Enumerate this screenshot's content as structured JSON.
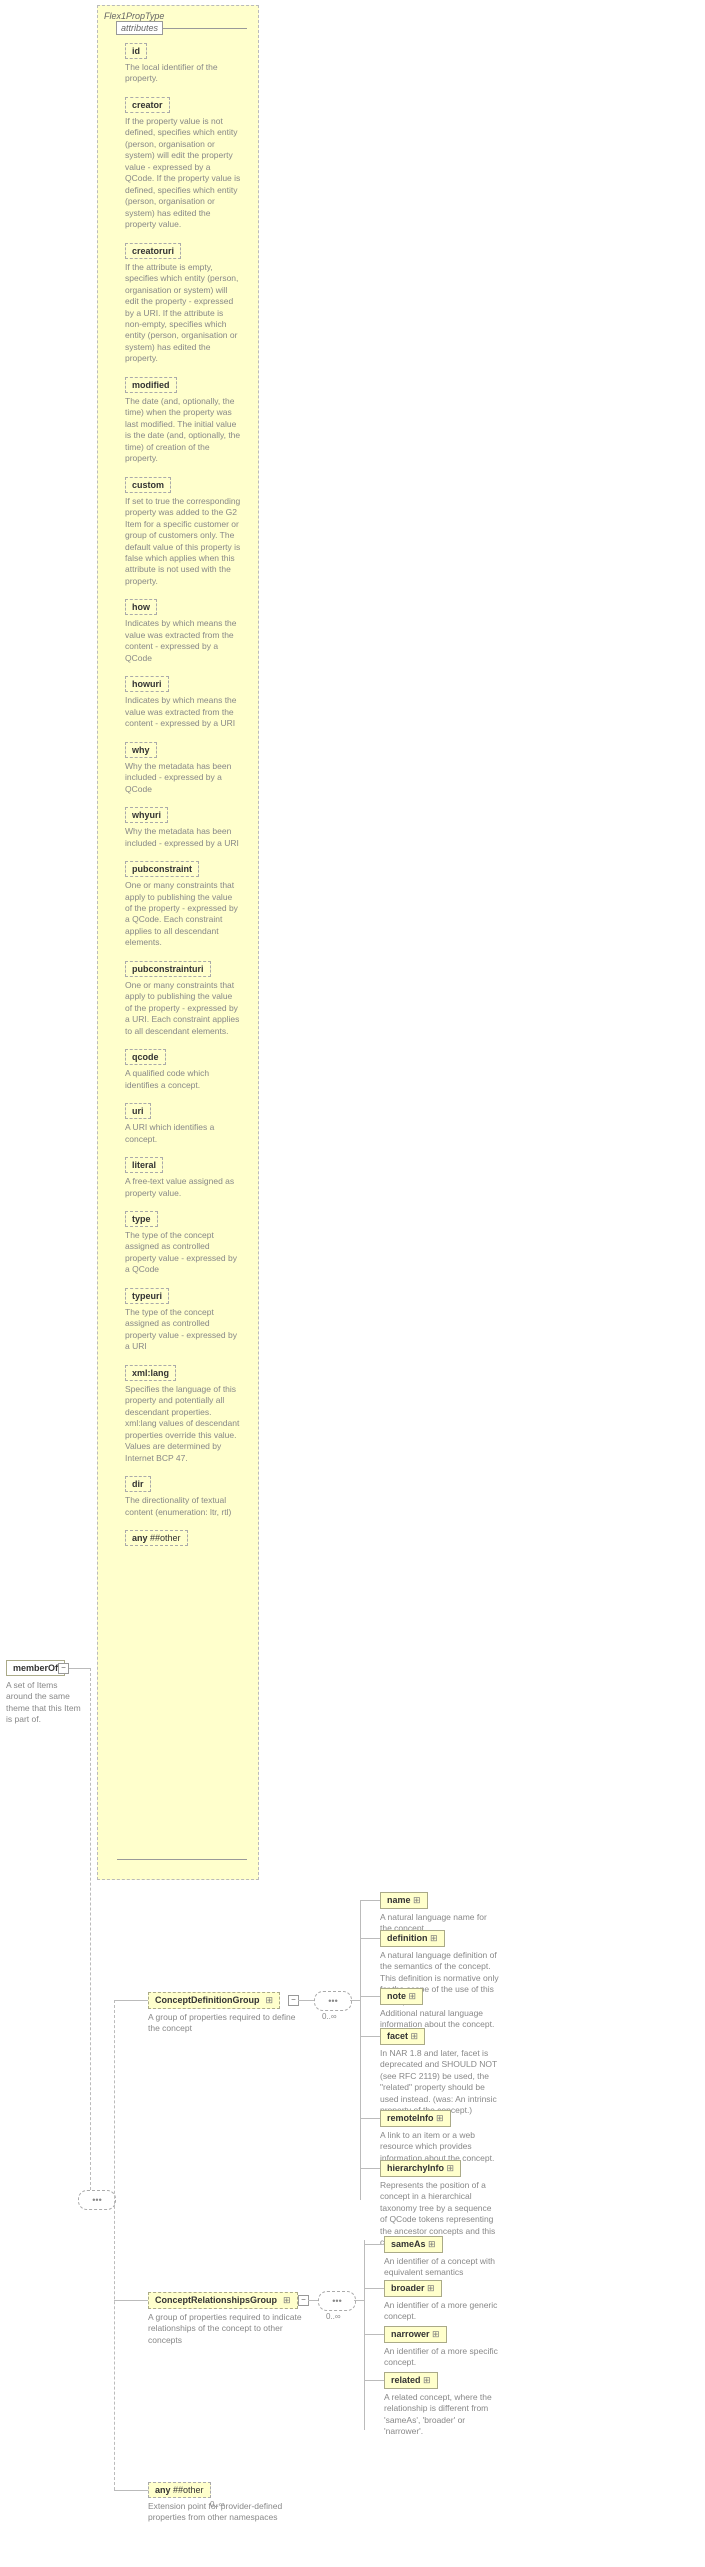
{
  "root": {
    "title": "Flex1PropType",
    "label": "memberOf",
    "desc": "A set of Items around the same theme that this Item is part of.",
    "attributes_label": "attributes"
  },
  "attributes": [
    {
      "name": "id",
      "desc": "The local identifier of the property."
    },
    {
      "name": "creator",
      "desc": "If the property value is not defined, specifies which entity (person, organisation or system) will edit the property value - expressed by a QCode. If the property value is defined, specifies which entity (person, organisation or system) has edited the property value."
    },
    {
      "name": "creatoruri",
      "desc": "If the attribute is empty, specifies which entity (person, organisation or system) will edit the property - expressed by a URI. If the attribute is non-empty, specifies which entity (person, organisation or system) has edited the property."
    },
    {
      "name": "modified",
      "desc": "The date (and, optionally, the time) when the property was last modified. The initial value is the date (and, optionally, the time) of creation of the property."
    },
    {
      "name": "custom",
      "desc": "If set to true the corresponding property was added to the G2 Item for a specific customer or group of customers only. The default value of this property is false which applies when this attribute is not used with the property."
    },
    {
      "name": "how",
      "desc": "Indicates by which means the value was extracted from the content - expressed by a QCode"
    },
    {
      "name": "howuri",
      "desc": "Indicates by which means the value was extracted from the content - expressed by a URI"
    },
    {
      "name": "why",
      "desc": "Why the metadata has been included - expressed by a QCode"
    },
    {
      "name": "whyuri",
      "desc": "Why the metadata has been included - expressed by a URI"
    },
    {
      "name": "pubconstraint",
      "desc": "One or many constraints that apply to publishing the value of the property - expressed by a QCode. Each constraint applies to all descendant elements."
    },
    {
      "name": "pubconstrainturi",
      "desc": "One or many constraints that apply to publishing the value of the property - expressed by a URI. Each constraint applies to all descendant elements."
    },
    {
      "name": "qcode",
      "desc": "A qualified code which identifies a concept."
    },
    {
      "name": "uri",
      "desc": "A URI which identifies a concept."
    },
    {
      "name": "literal",
      "desc": "A free-text value assigned as property value."
    },
    {
      "name": "type",
      "desc": "The type of the concept assigned as controlled property value - expressed by a QCode"
    },
    {
      "name": "typeuri",
      "desc": "The type of the concept assigned as controlled property value - expressed by a URI"
    },
    {
      "name": "xml:lang",
      "desc": "Specifies the language of this property and potentially all descendant properties. xml:lang values of descendant properties override this value. Values are determined by Internet BCP 47."
    },
    {
      "name": "dir",
      "desc": "The directionality of textual content (enumeration: ltr, rtl)"
    }
  ],
  "any_attr": "##other",
  "groups": {
    "def": {
      "label": "ConceptDefinitionGroup",
      "desc": "A group of properties required to define the concept"
    },
    "rel": {
      "label": "ConceptRelationshipsGroup",
      "desc": "A group of properties required to indicate relationships of the concept to other concepts"
    }
  },
  "def_children": [
    {
      "name": "name",
      "desc": "A natural language name for the concept."
    },
    {
      "name": "definition",
      "desc": "A natural language definition of the semantics of the concept. This definition is normative only for the scope of the use of this concept."
    },
    {
      "name": "note",
      "desc": "Additional natural language information about the concept."
    },
    {
      "name": "facet",
      "desc": "In NAR 1.8 and later, facet is deprecated and SHOULD NOT (see RFC 2119) be used, the \"related\" property should be used instead. (was: An intrinsic property of the concept.)"
    },
    {
      "name": "remoteInfo",
      "desc": "A link to an item or a web resource which provides information about the concept."
    },
    {
      "name": "hierarchyInfo",
      "desc": "Represents the position of a concept in a hierarchical taxonomy tree by a sequence of QCode tokens representing the ancestor concepts and this concept"
    }
  ],
  "rel_children": [
    {
      "name": "sameAs",
      "desc": "An identifier of a concept with equivalent semantics"
    },
    {
      "name": "broader",
      "desc": "An identifier of a more generic concept."
    },
    {
      "name": "narrower",
      "desc": "An identifier of a more specific concept."
    },
    {
      "name": "related",
      "desc": "A related concept, where the relationship is different from 'sameAs', 'broader' or 'narrower'."
    }
  ],
  "any_elem": {
    "label": "##other",
    "desc": "Extension point for provider-defined properties from other namespaces"
  },
  "oc": "0..∞"
}
